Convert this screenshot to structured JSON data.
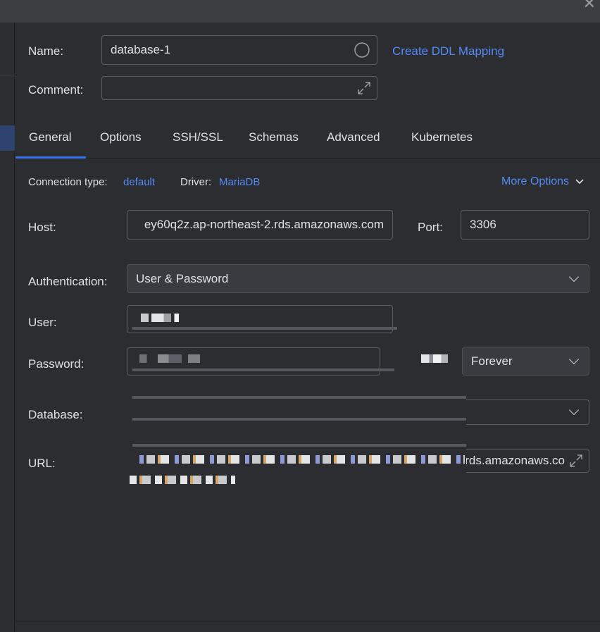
{
  "window": {
    "close_glyph": "✕"
  },
  "name": {
    "label": "Name:",
    "value": "database-1"
  },
  "ddl_link": "Create DDL Mapping",
  "comment": {
    "label": "Comment:",
    "value": ""
  },
  "tabs": [
    {
      "label": "General",
      "active": true
    },
    {
      "label": "Options"
    },
    {
      "label": "SSH/SSL"
    },
    {
      "label": "Schemas"
    },
    {
      "label": "Advanced"
    },
    {
      "label": "Kubernetes"
    }
  ],
  "connection": {
    "type_label": "Connection type:",
    "type_value": "default",
    "driver_label": "Driver:",
    "driver_value": "MariaDB",
    "more_options": "More Options"
  },
  "host": {
    "label": "Host:",
    "value": "ey60q2z.ap-northeast-2.rds.amazonaws.com"
  },
  "port": {
    "label": "Port:",
    "value": "3306"
  },
  "authentication": {
    "label": "Authentication:",
    "value": "User & Password"
  },
  "user": {
    "label": "User:"
  },
  "password": {
    "label": "Password:",
    "save_value": "Forever"
  },
  "database": {
    "label": "Database:"
  },
  "url": {
    "label": "URL:",
    "visible_tail": "rds.amazonaws.co"
  },
  "icons": {
    "name_status": "circle-icon",
    "comment_expand": "expand-icon",
    "url_expand": "expand-icon",
    "chevron": "chevron-down-icon"
  },
  "colors": {
    "accent": "#548af7",
    "tab_underline": "#3574f0",
    "selection": "#2e436e"
  }
}
